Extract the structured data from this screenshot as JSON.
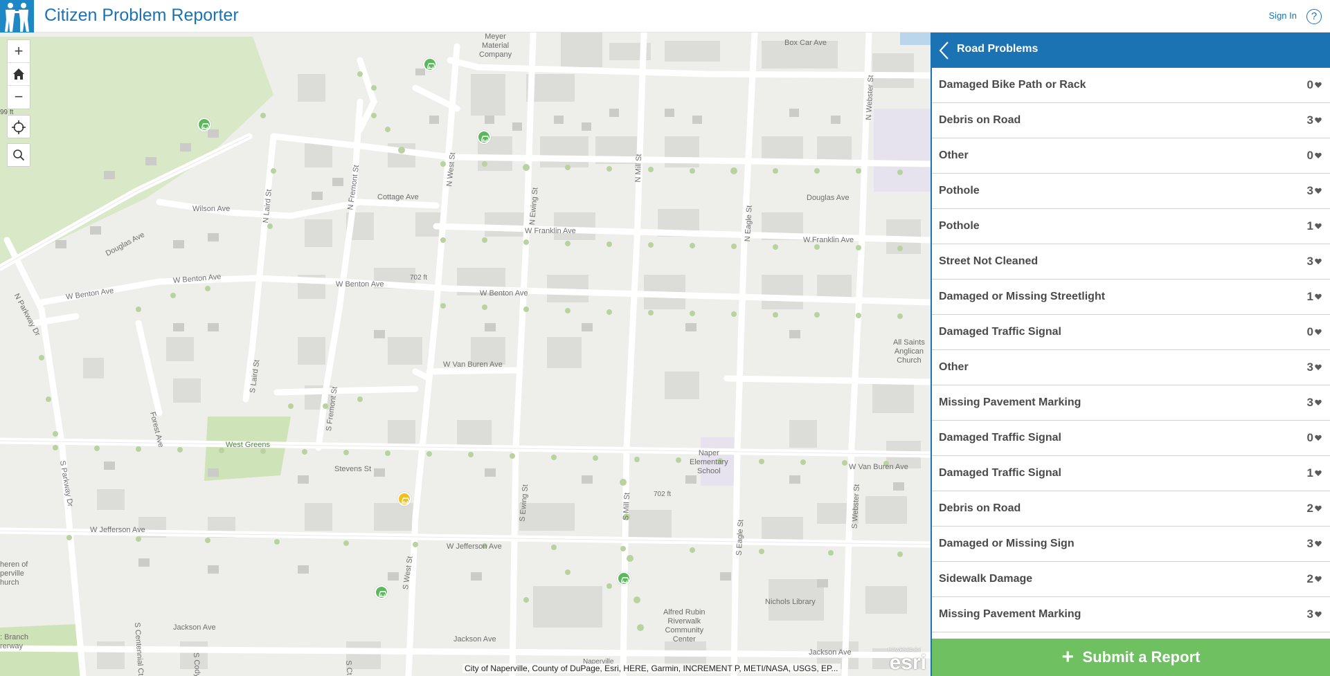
{
  "app": {
    "title": "Citizen Problem Reporter",
    "sign_in": "Sign In",
    "help_icon": "question-circle-icon",
    "logo_icon": "two-people-icon"
  },
  "map": {
    "controls": {
      "zoom_in": "+",
      "zoom_out": "−",
      "home_icon": "home-icon",
      "locate_icon": "locate-crosshair-icon",
      "search_icon": "search-icon"
    },
    "scale_text": "99 ft",
    "street_labels": [
      "Douglas Ave",
      "Wilson Ave",
      "Cottage Ave",
      "W Franklin Ave",
      "W.Franklin Ave",
      "W Benton Ave",
      "W Benton Ave",
      "W Benton Ave",
      "W Benton Ave",
      "W Van Buren Ave",
      "W Van Buren Ave",
      "Stevens St",
      "W Jefferson Ave",
      "W Jefferson Ave",
      "Jackson Ave",
      "Jackson Ave",
      "Jackson Ave",
      "Douglas Ave",
      "Box Car Ave",
      "N Laird St",
      "N Fremont St",
      "N West St",
      "N Ewing St",
      "N Mill St",
      "N Eagle St",
      "N Webster St",
      "S Laird St",
      "S Fremont St",
      "S West St",
      "S Ewing St",
      "S Mill St",
      "S Eagle St",
      "S Webster St",
      "N Parkway Dr",
      "S Parkway Dr",
      "Forest Ave",
      "S Cody",
      "S Centennial Ct",
      "S Ct"
    ],
    "place_labels": {
      "meyer": "Meyer\nMaterial\nCompany",
      "west_greens": "West Greens",
      "naper_school": "Naper\nElementary\nSchool",
      "all_saints": "All Saints\nAnglican\nChurch",
      "nichols": "Nichols Library",
      "alfred_rubin": "Alfred Rubin\nRiverwalk\nCommunity\nCenter",
      "lutheran": "heren of\nperville\nhurch",
      "dupage": ": Branch\nrerway",
      "elev1": "702 ft",
      "elev2": "702 ft",
      "naperville_small": "Naperville"
    },
    "attribution": "City of Naperville, County of DuPage, Esri, HERE, Garmin, INCREMENT P, METI/NASA, USGS, EP...",
    "powered_by": "POWERED BY",
    "esri_logo": "esri",
    "markers": [
      {
        "status": "open",
        "color": "#5cb85c",
        "icon": "car-icon"
      },
      {
        "status": "open",
        "color": "#5cb85c",
        "icon": "car-icon"
      },
      {
        "status": "open",
        "color": "#5cb85c",
        "icon": "car-icon"
      },
      {
        "status": "open",
        "color": "#5cb85c",
        "icon": "car-icon"
      },
      {
        "status": "open",
        "color": "#5cb85c",
        "icon": "car-icon"
      },
      {
        "status": "selected",
        "color": "#f2c01e",
        "icon": "car-icon"
      }
    ]
  },
  "panel": {
    "title": "Road Problems",
    "back_icon": "chevron-left-icon",
    "items": [
      {
        "label": "Damaged Bike Path or Rack",
        "votes": "0"
      },
      {
        "label": "Debris on Road",
        "votes": "3"
      },
      {
        "label": "Other",
        "votes": "0"
      },
      {
        "label": "Pothole",
        "votes": "3"
      },
      {
        "label": "Pothole",
        "votes": "1"
      },
      {
        "label": "Street Not Cleaned",
        "votes": "3"
      },
      {
        "label": "Damaged or Missing Streetlight",
        "votes": "1"
      },
      {
        "label": "Damaged Traffic Signal",
        "votes": "0"
      },
      {
        "label": "Other",
        "votes": "3"
      },
      {
        "label": "Missing Pavement Marking",
        "votes": "3"
      },
      {
        "label": "Damaged Traffic Signal",
        "votes": "0"
      },
      {
        "label": "Damaged Traffic Signal",
        "votes": "1"
      },
      {
        "label": "Debris on Road",
        "votes": "2"
      },
      {
        "label": "Damaged or Missing Sign",
        "votes": "3"
      },
      {
        "label": "Sidewalk Damage",
        "votes": "2"
      },
      {
        "label": "Missing Pavement Marking",
        "votes": "3"
      }
    ],
    "vote_icon": "heart-icon",
    "submit": {
      "icon": "plus-icon",
      "plus": "+",
      "label": "Submit a Report"
    }
  },
  "colors": {
    "brand": "#1b73b4",
    "submit": "#6ec061",
    "marker_open": "#5cb85c",
    "marker_selected": "#f2c01e",
    "park": "#cfe3b9"
  }
}
